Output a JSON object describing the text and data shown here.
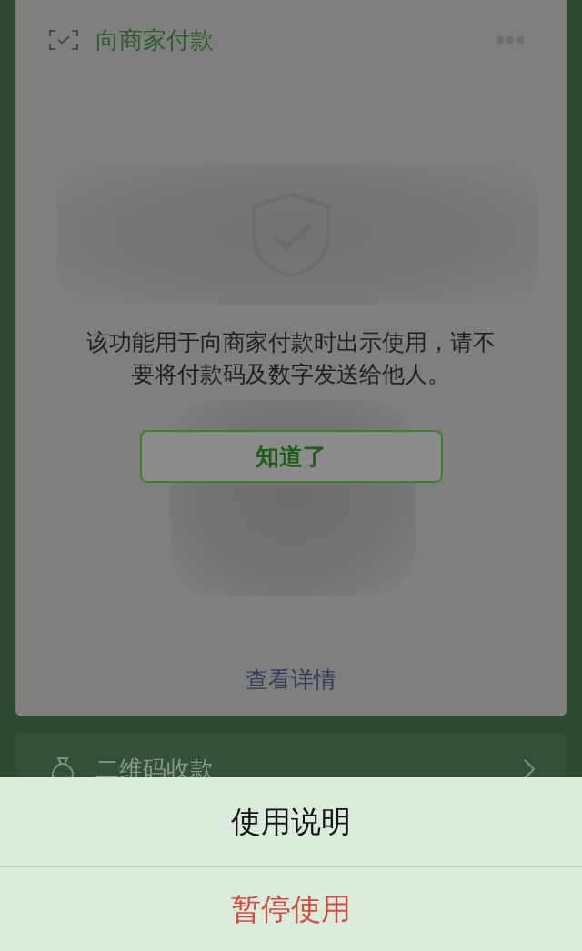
{
  "card": {
    "title": "向商家付款",
    "message": "该功能用于向商家付款时出示使用，请不要将付款码及数字发送给他人。",
    "confirm_button": "知道了",
    "details_link": "查看详情"
  },
  "list_rows": [
    {
      "label": "二维码收款"
    }
  ],
  "action_sheet": {
    "items": [
      {
        "label": "使用说明",
        "kind": "normal"
      },
      {
        "label": "暂停使用",
        "kind": "destructive"
      }
    ]
  }
}
